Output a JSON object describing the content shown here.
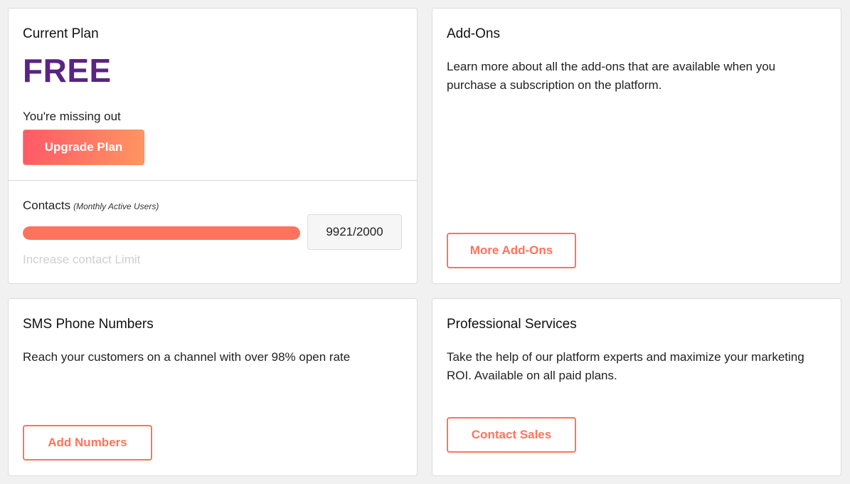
{
  "colors": {
    "brand_purple": "#5a2482",
    "accent_coral": "#ff735e",
    "gradient_start": "#ff5a67",
    "gradient_end": "#ff9462",
    "disabled_text": "#cfcfcf",
    "page_bg": "#f1f1f1"
  },
  "current_plan": {
    "title": "Current Plan",
    "plan_name": "FREE",
    "missing_text": "You're missing out",
    "upgrade_label": "Upgrade Plan",
    "contacts_label": "Contacts",
    "contacts_sub": "(Monthly Active Users)",
    "usage_display": "9921/2000",
    "usage_used": 9921,
    "usage_limit": 2000,
    "usage_fill_fraction": 1.0,
    "increase_link": "Increase contact Limit"
  },
  "addons": {
    "title": "Add-Ons",
    "description": "Learn more about all the add-ons that are available when you purchase a subscription on the platform.",
    "button_label": "More Add-Ons"
  },
  "sms": {
    "title": "SMS Phone Numbers",
    "description": "Reach your customers on a channel with over 98% open rate",
    "button_label": "Add Numbers"
  },
  "professional": {
    "title": "Professional Services",
    "description": "Take the help of our platform experts and maximize your marketing ROI. Available on all paid plans.",
    "button_label": "Contact Sales"
  }
}
